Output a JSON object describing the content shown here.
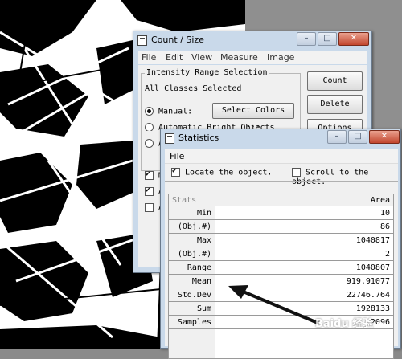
{
  "count_size_window": {
    "title": "Count / Size",
    "menu": [
      "File",
      "Edit",
      "View",
      "Measure",
      "Image"
    ],
    "group_title": "Intensity Range Selection",
    "classes_text": "All Classes Selected",
    "manual_label": "Manual:",
    "select_colors_label": "Select Colors ...",
    "auto_bright_label": "Automatic Bright Objects",
    "auto_label_partial": "A",
    "count_label": "Count",
    "delete_label": "Delete",
    "options_label": "Options",
    "left_checks": [
      "M",
      "A",
      "A"
    ]
  },
  "statistics_window": {
    "title": "Statistics",
    "menu_file": "File",
    "locate_label": "Locate the object.",
    "locate_checked": true,
    "scroll_label": "Scroll to the object.",
    "scroll_checked": false,
    "table": {
      "header": [
        "Stats",
        "Area"
      ],
      "rows": [
        {
          "label": "Min",
          "value": "10"
        },
        {
          "label": "(Obj.#)",
          "value": "86"
        },
        {
          "label": "Max",
          "value": "1040817"
        },
        {
          "label": "(Obj.#)",
          "value": "2"
        },
        {
          "label": "Range",
          "value": "1040807"
        },
        {
          "label": "Mean",
          "value": "919.91077"
        },
        {
          "label": "Std.Dev",
          "value": "22746.764"
        },
        {
          "label": "Sum",
          "value": "1928133"
        },
        {
          "label": "Samples",
          "value": "2096"
        }
      ]
    }
  },
  "colors": {
    "window_frame": "#c9d9ea",
    "close_button": "#c2462e",
    "annotation_arrow": "#111111"
  },
  "icons": [
    "app-window-icon",
    "minimize-icon",
    "maximize-icon",
    "close-icon",
    "checkbox-icon",
    "radio-icon",
    "annotation-arrow-icon",
    "watermark-logo"
  ],
  "watermark": "Baidu 经验"
}
